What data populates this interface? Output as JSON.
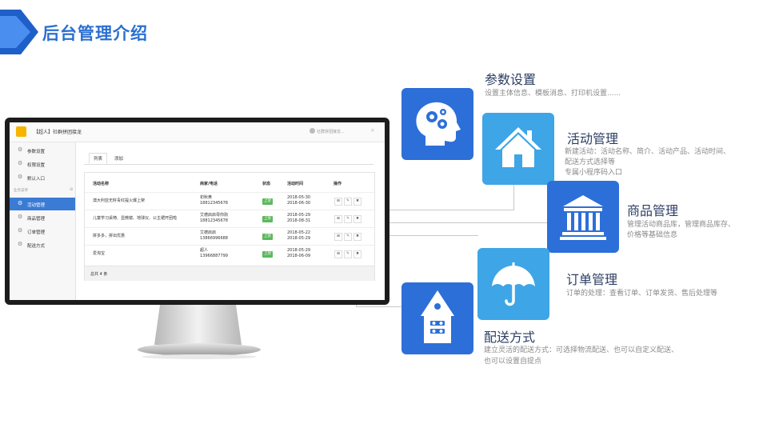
{
  "page": {
    "title": "后台管理介绍"
  },
  "app": {
    "name": "【超人】社群拼团接龙",
    "user": "社群拼团接龙...",
    "close": "×",
    "sidebar": {
      "top_items": [
        {
          "label": "参数设置"
        },
        {
          "label": "权限设置"
        },
        {
          "label": "默认入口"
        }
      ],
      "section_label": "业务菜单",
      "section_toggle": "⊖",
      "items": [
        {
          "label": "活动管理",
          "active": true
        },
        {
          "label": "商品管理",
          "active": false
        },
        {
          "label": "订单管理",
          "active": false
        },
        {
          "label": "配送方式",
          "active": false
        }
      ]
    },
    "tabs": [
      {
        "label": "列表",
        "active": true
      },
      {
        "label": "添加",
        "active": false
      }
    ],
    "table": {
      "headers": [
        "活动名称",
        "商家/电话",
        "状态",
        "活动时间",
        "操作"
      ],
      "rows": [
        {
          "name": "澳大利亚无籽青红提火爆上架",
          "merchant": "初秋黄",
          "phone": "18812345678",
          "status": "上架",
          "start": "2018-05-30",
          "end": "2018-06-30"
        },
        {
          "name": "儿童学习桌椅、显微镜、地球仪、公主裙开团啦",
          "merchant": "艾德启启母你驹",
          "phone": "18812345678",
          "status": "上架",
          "start": "2018-05-29",
          "end": "2018-08-31"
        },
        {
          "name": "拼多多，拼出优惠",
          "merchant": "艾德启启",
          "phone": "13866996688",
          "status": "上架",
          "start": "2018-05-22",
          "end": "2018-05-29"
        },
        {
          "name": "爱淘宝",
          "merchant": "超人",
          "phone": "13966887799",
          "status": "上架",
          "start": "2018-05-29",
          "end": "2018-06-09"
        }
      ],
      "ops": [
        "⊞",
        "✎",
        "✖"
      ],
      "footer": "总共 4 条"
    }
  },
  "features": [
    {
      "id": "params",
      "title": "参数设置",
      "desc": [
        "设置主体信息、模板消息、打印机设置......"
      ],
      "icon": "head-gears-icon",
      "color": "#2d6fd8"
    },
    {
      "id": "activity",
      "title": "活动管理",
      "desc": [
        "新建活动：活动名称、简介、活动产品、活动时间、",
        "配送方式选择等",
        "专属小程序码入口"
      ],
      "icon": "house-icon",
      "color": "#3ea5e6"
    },
    {
      "id": "product",
      "title": "商品管理",
      "desc": [
        "管理活动商品库，管理商品库存、",
        "价格等基础信息"
      ],
      "icon": "bank-building-icon",
      "color": "#2d6fd8"
    },
    {
      "id": "order",
      "title": "订单管理",
      "desc": [
        "订单的处理：查看订单、订单发货、售后处理等"
      ],
      "icon": "umbrella-icon",
      "color": "#3ea5e6"
    },
    {
      "id": "delivery",
      "title": "配送方式",
      "desc": [
        "建立灵活的配送方式：可选择物流配送、也可以自定义配送、",
        "也可以设置自提点"
      ],
      "icon": "birdhouse-icon",
      "color": "#2d6fd8"
    }
  ],
  "colors": {
    "accent": "#2b6fd1",
    "tile_dark": "#2d6fd8",
    "tile_light": "#3ea5e6",
    "status_green": "#5cb85c"
  }
}
